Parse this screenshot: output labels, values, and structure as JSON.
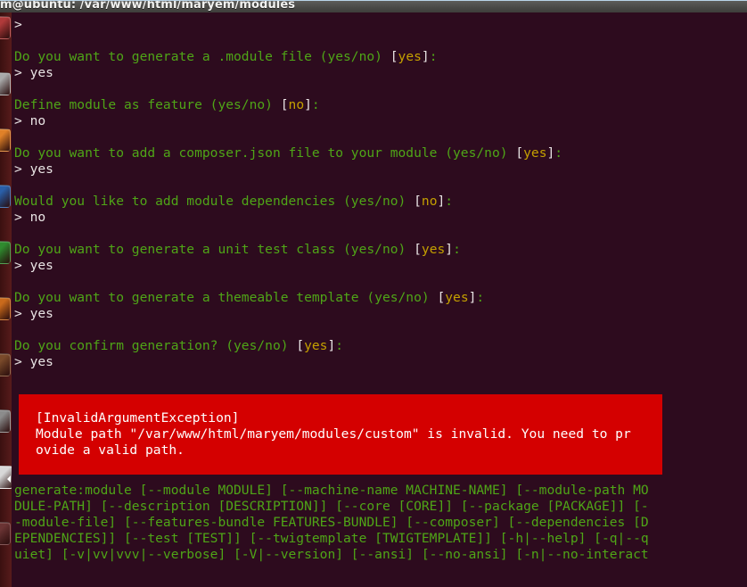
{
  "window": {
    "title": "m@ubuntu: /var/www/html/maryem/modules"
  },
  "launcher": {
    "items": [
      {
        "name": "ubuntu-software-icon",
        "color": "#b03a3a"
      },
      {
        "name": "files-icon",
        "color": "#a9a9a9"
      },
      {
        "name": "firefox-icon",
        "color": "#e08128"
      },
      {
        "name": "thunderbird-icon",
        "color": "#2a5fa8"
      },
      {
        "name": "libreoffice-calc-icon",
        "color": "#2f8b2f"
      },
      {
        "name": "libreoffice-impress-icon",
        "color": "#c96a1c"
      },
      {
        "name": "amazon-icon",
        "color": "#7a4a2a"
      },
      {
        "name": "system-settings-icon",
        "color": "#8c8c8c"
      },
      {
        "name": "terminal-icon",
        "color": "#d8d8d8"
      },
      {
        "name": "trash-icon",
        "color": "#6b3434"
      }
    ]
  },
  "terminal": {
    "prompt_symbol": ">",
    "answer_prefix": "> ",
    "exchanges": [
      {
        "question": "",
        "prompt_only": true
      },
      {
        "question_pre": "Do you want to generate a .module file (yes/no) ",
        "bracket_open": "[",
        "default": "yes",
        "bracket_close": "]",
        "colon": ":",
        "answer": "yes"
      },
      {
        "question_pre": "Define module as feature (yes/no) ",
        "bracket_open": "[",
        "default": "no",
        "bracket_close": "]",
        "colon": ":",
        "answer": "no"
      },
      {
        "question_pre": "Do you want to add a composer.json file to your module (yes/no) ",
        "bracket_open": "[",
        "default": "yes",
        "bracket_close": "]",
        "colon": ":",
        "answer": "yes"
      },
      {
        "question_pre": "Would you like to add module dependencies (yes/no) ",
        "bracket_open": "[",
        "default": "no",
        "bracket_close": "]",
        "colon": ":",
        "answer": "no"
      },
      {
        "question_pre": "Do you want to generate a unit test class (yes/no) ",
        "bracket_open": "[",
        "default": "yes",
        "bracket_close": "]",
        "colon": ":",
        "answer": "yes"
      },
      {
        "question_pre": "Do you want to generate a themeable template (yes/no) ",
        "bracket_open": "[",
        "default": "yes",
        "bracket_close": "]",
        "colon": ":",
        "answer": "yes"
      },
      {
        "question_pre": "Do you confirm generation? (yes/no) ",
        "bracket_open": "[",
        "default": "yes",
        "bracket_close": "]",
        "colon": ":",
        "answer": "yes"
      }
    ],
    "error": {
      "exception": "[InvalidArgumentException]",
      "message_line_1": "Module path \"/var/www/html/maryem/modules/custom\" is invalid. You need to pr",
      "message_line_2": "ovide a valid path.",
      "background_color": "#d40000",
      "text_color": "#ffffff"
    },
    "usage_lines": [
      "generate:module [--module MODULE] [--machine-name MACHINE-NAME] [--module-path MO",
      "DULE-PATH] [--description [DESCRIPTION]] [--core [CORE]] [--package [PACKAGE]] [-",
      "-module-file] [--features-bundle FEATURES-BUNDLE] [--composer] [--dependencies [D",
      "EPENDENCIES]] [--test [TEST]] [--twigtemplate [TWIGTEMPLATE]] [-h|--help] [-q|--q",
      "uiet] [-v|vv|vvv|--verbose] [-V|--version] [--ansi] [--no-ansi] [-n|--no-interact"
    ]
  },
  "colors": {
    "terminal_background": "#2d0b1e",
    "question_green": "#4fa517",
    "answer_white": "#e9e4e4",
    "default_yellow": "#c4a000",
    "error_red": "#d40000",
    "titlebar_gray": "#4a4a47",
    "launcher_maroon": "#4a1616"
  }
}
